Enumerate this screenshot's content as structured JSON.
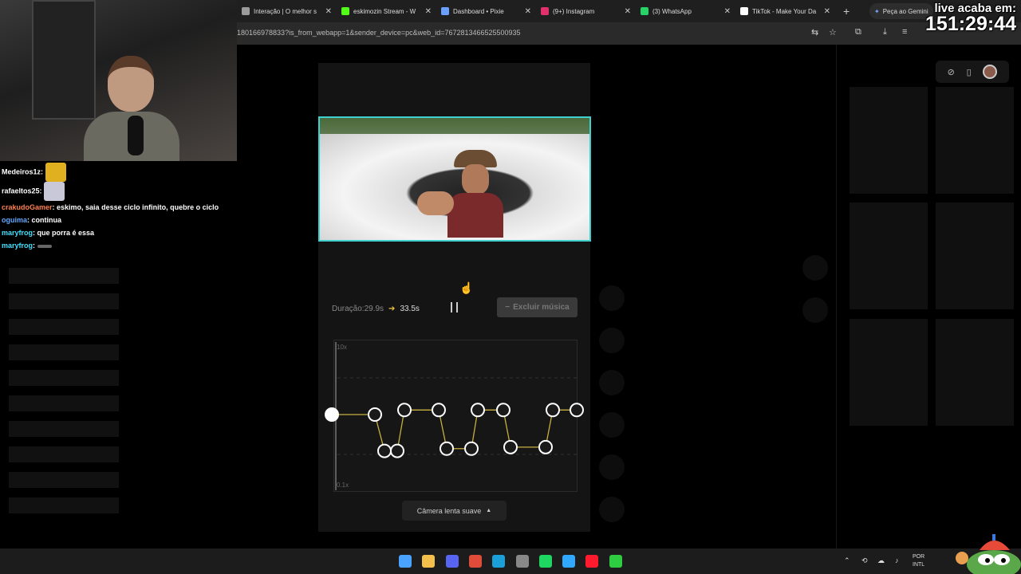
{
  "browser": {
    "tabs": [
      {
        "label": "Interação | O melhor s",
        "icon_color": "#9b9b9b"
      },
      {
        "label": "eskimozin Stream - W",
        "icon_color": "#53fc18"
      },
      {
        "label": "Dashboard • Pixie",
        "icon_color": "#6aa0ff"
      },
      {
        "label": "(9+) Instagram",
        "icon_color": "#e1306c"
      },
      {
        "label": "(3) WhatsApp",
        "icon_color": "#25d366"
      },
      {
        "label": "TikTok - Make Your Da",
        "icon_color": "#ffffff"
      }
    ],
    "new_tab": "+",
    "gemini_label": "Peça ao Gemini",
    "url": "180166978833?is_from_webapp=1&sender_device=pc&web_id=7672813466525500935"
  },
  "overlay": {
    "timer_title": "live acaba em:",
    "timer_value": "151:29:44"
  },
  "chat": [
    {
      "user": "Medeiros1z",
      "user_color": "#ffffff",
      "text": "",
      "emote": "#e0b020"
    },
    {
      "user": "rafaeltos25",
      "user_color": "#ffffff",
      "text": "",
      "emote": "#c8c8d8"
    },
    {
      "user": "crakudoGamer",
      "user_color": "#ff7f50",
      "text": "eskimo, saia desse ciclo infinito, quebre o ciclo",
      "emote": ""
    },
    {
      "user": "oguima",
      "user_color": "#5fa8ff",
      "text": "continua",
      "emote": ""
    },
    {
      "user": "maryfrog",
      "user_color": "#40e0ff",
      "text": "que porra é essa",
      "emote": ""
    },
    {
      "user": "maryfrog",
      "user_color": "#40e0ff",
      "text": "",
      "emote": "#666666"
    }
  ],
  "editor": {
    "duration_label": "Duração:29.9s",
    "duration_arrow": "➔",
    "duration_new": "33.5s",
    "remove_music_label": "Excluir música",
    "remove_music_icon": "−",
    "graph_top_label": "10x",
    "graph_bottom_label": "0.1x",
    "camera_button_label": "Câmera lenta suave",
    "camera_button_icon": "▲",
    "curve_color": "#c8b040",
    "speed_points_log10": [
      0,
      0,
      -0.48,
      -0.48,
      0.06,
      0.06,
      -0.45,
      -0.45,
      0.06,
      0.06,
      -0.43,
      -0.43,
      0.06,
      0.06
    ]
  },
  "right_toolbar": {
    "icons": [
      "compass-icon",
      "phone-icon"
    ]
  },
  "taskbar": {
    "icons": [
      {
        "name": "windows-start-icon",
        "color": "#4aa3ff"
      },
      {
        "name": "file-explorer-icon",
        "color": "#f3c14b"
      },
      {
        "name": "discord-icon",
        "color": "#5865f2"
      },
      {
        "name": "chrome-icon",
        "color": "#e04b3a"
      },
      {
        "name": "steam-icon",
        "color": "#1b9fd8"
      },
      {
        "name": "obs-icon",
        "color": "#888888"
      },
      {
        "name": "spotify-icon",
        "color": "#1ed760"
      },
      {
        "name": "photoshop-icon",
        "color": "#31a8ff"
      },
      {
        "name": "opera-icon",
        "color": "#ff1b2d"
      },
      {
        "name": "xbox-icon",
        "color": "#2ecc40"
      }
    ],
    "lang_line1": "POR",
    "lang_line2": "INTL"
  }
}
